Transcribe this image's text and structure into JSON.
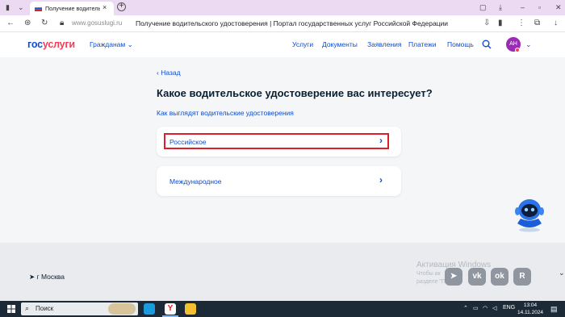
{
  "browser": {
    "tab_title": "Получение водительск",
    "tab_close": "×",
    "new_tab": "+",
    "url": "www.gosuslugi.ru",
    "page_title": "Получение водительского удостоверения | Портал государственных услуг Российской Федерации"
  },
  "header": {
    "logo_part1": "гос",
    "logo_part2": "услуги",
    "citizens_label": "Гражданам",
    "nav": [
      "Услуги",
      "Документы",
      "Заявления",
      "Платежи",
      "Помощь"
    ],
    "avatar_initials": "АН"
  },
  "main": {
    "back_label": "Назад",
    "heading": "Какое водительское удостоверение вас интересует?",
    "sublink": "Как выглядят водительские удостоверения",
    "options": [
      {
        "label": "Российское"
      },
      {
        "label": "Международное"
      }
    ]
  },
  "footer": {
    "city": "г Москва",
    "activation_title": "Активация Windows",
    "activation_line1": "Чтобы ак",
    "activation_line2": "разделе \"П",
    "social": [
      "Telegram",
      "VK",
      "OK",
      "Rutube"
    ]
  },
  "taskbar": {
    "search_label": "Поиск",
    "language": "ENG",
    "time": "13:04",
    "date": "14.11.2024"
  },
  "colors": {
    "brand_blue": "#0d4cd3",
    "brand_red": "#ee3f58",
    "highlight_red": "#e01e2b",
    "page_bg": "#f5f6f8"
  }
}
